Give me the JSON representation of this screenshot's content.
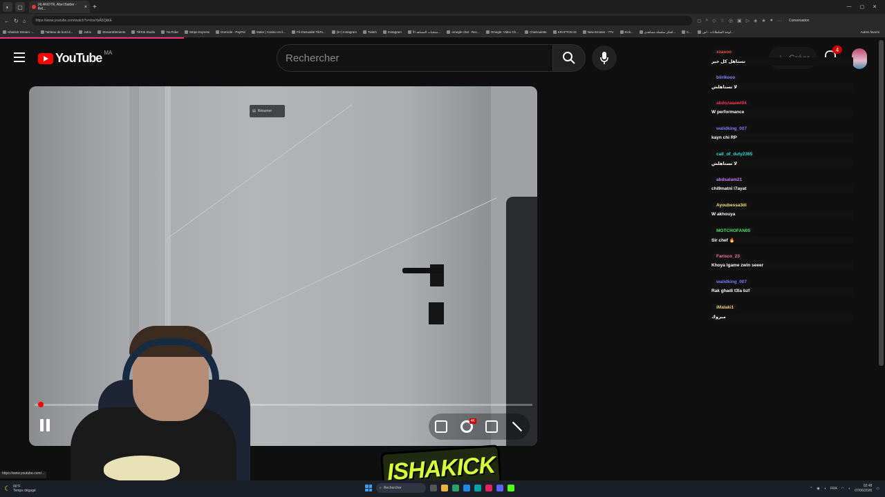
{
  "browser": {
    "tab_title": "(4) ANOTR, Abel Balder - Rel...",
    "url": "https://www.youtube.com/watch?v=coaYpA5QkkE",
    "conversation_label": "Conversation",
    "bookmarks": [
      "Ishakick Stream -...",
      "Tableau de bord d...",
      "Jotrix",
      "StreamElements",
      "TikTok Studio",
      "YouTube",
      "Stripe Express",
      "Domicile - PayPal",
      "Stake | Casino en li...",
      "Fil d'actualité TikTo...",
      "(9+) Instagram",
      "Twitch",
      "Instagram",
      "منتخبات المشاهد الأ...",
      "omegle chat - Rec...",
      "Omegle: Video Ch...",
      "Chatroulette",
      "KRAFTON ID",
      "New Emotes - 7TV",
      "Kick...",
      "افتكر سلسلة مشاهدي...",
      "C...",
      "لوحة السلطانات - اس..."
    ],
    "other_bookmarks": "Autres favoris",
    "status_url": "https://www.youtube.com/..."
  },
  "youtube": {
    "logo_text": "YouTube",
    "country_code": "MA",
    "search_placeholder": "Rechercher",
    "create_label": "Créer",
    "notification_count": "4"
  },
  "player": {
    "tooltip": "Résumer",
    "hd_badge": "4K",
    "progress": 0.01
  },
  "overlay": {
    "brand": "ISHAKICK"
  },
  "chat": [
    {
      "user": "xzasoo",
      "color": "#ff4d4d",
      "text": "تستاهل كل خير"
    },
    {
      "user": "biirikooo",
      "color": "#8a8aff",
      "text": "لا تستاهلش"
    },
    {
      "user": "abdozaaawi04",
      "color": "#ff3355",
      "text": "W performance"
    },
    {
      "user": "walidking_007",
      "color": "#7c7cff",
      "text": "kayn chi RP"
    },
    {
      "user": "call_of_duty2365",
      "color": "#38d9d9",
      "text": "لا تستاهلش"
    },
    {
      "user": "abdsalam21",
      "color": "#c77dff",
      "text": "chi9matni l7ayat"
    },
    {
      "user": "Ayoubessa3di",
      "color": "#f7e27a",
      "text": "W akhouya"
    },
    {
      "user": "MOTCHOFAN05",
      "color": "#4ee06a",
      "text": "Sir chef 🔥"
    },
    {
      "user": "Farisco_23",
      "color": "#ff6fa8",
      "text": "Khoya lgame zwin seeer"
    },
    {
      "user": "walidking_007",
      "color": "#7c7cff",
      "text": "Rak ghadi t3la bzf"
    },
    {
      "user": "iMalaki1",
      "color": "#f5d37a",
      "text": "مبروك"
    }
  ],
  "taskbar": {
    "temp": "66°F",
    "weather": "Temps dégagé",
    "search_placeholder": "Rechercher",
    "lang": "FRA",
    "time": "02:48",
    "date": "07/06/2026"
  }
}
